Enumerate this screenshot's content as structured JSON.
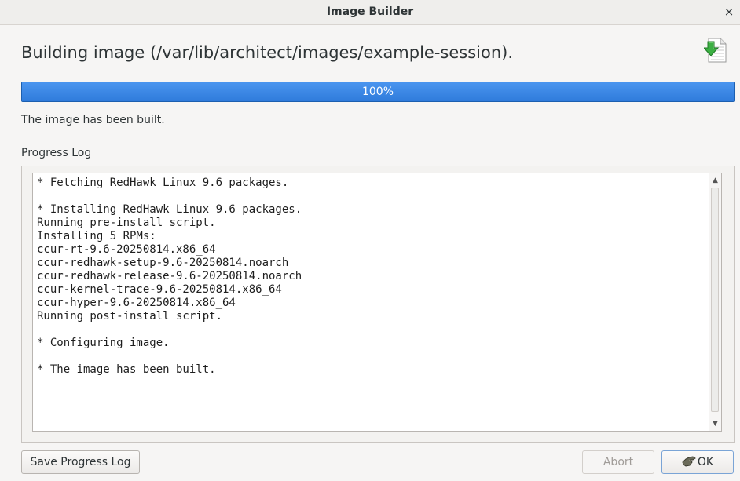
{
  "window": {
    "title": "Image Builder",
    "close_glyph": "×"
  },
  "header": {
    "heading": "Building image (/var/lib/architect/images/example-session).",
    "icon": "download-document-icon"
  },
  "progress": {
    "percent_label": "100%",
    "value": 1.0,
    "color": "#3584e4"
  },
  "status_text": "The image has been built.",
  "log": {
    "label": "Progress Log",
    "text": "* Fetching RedHawk Linux 9.6 packages.\n\n* Installing RedHawk Linux 9.6 packages.\nRunning pre-install script.\nInstalling 5 RPMs:\nccur-rt-9.6-20250814.x86_64\nccur-redhawk-setup-9.6-20250814.noarch\nccur-redhawk-release-9.6-20250814.noarch\nccur-kernel-trace-9.6-20250814.x86_64\nccur-hyper-9.6-20250814.x86_64\nRunning post-install script.\n\n* Configuring image.\n\n* The image has been built."
  },
  "buttons": {
    "save_log": "Save Progress Log",
    "abort": "Abort",
    "ok": "OK",
    "ok_icon": "ok-hand-icon"
  }
}
